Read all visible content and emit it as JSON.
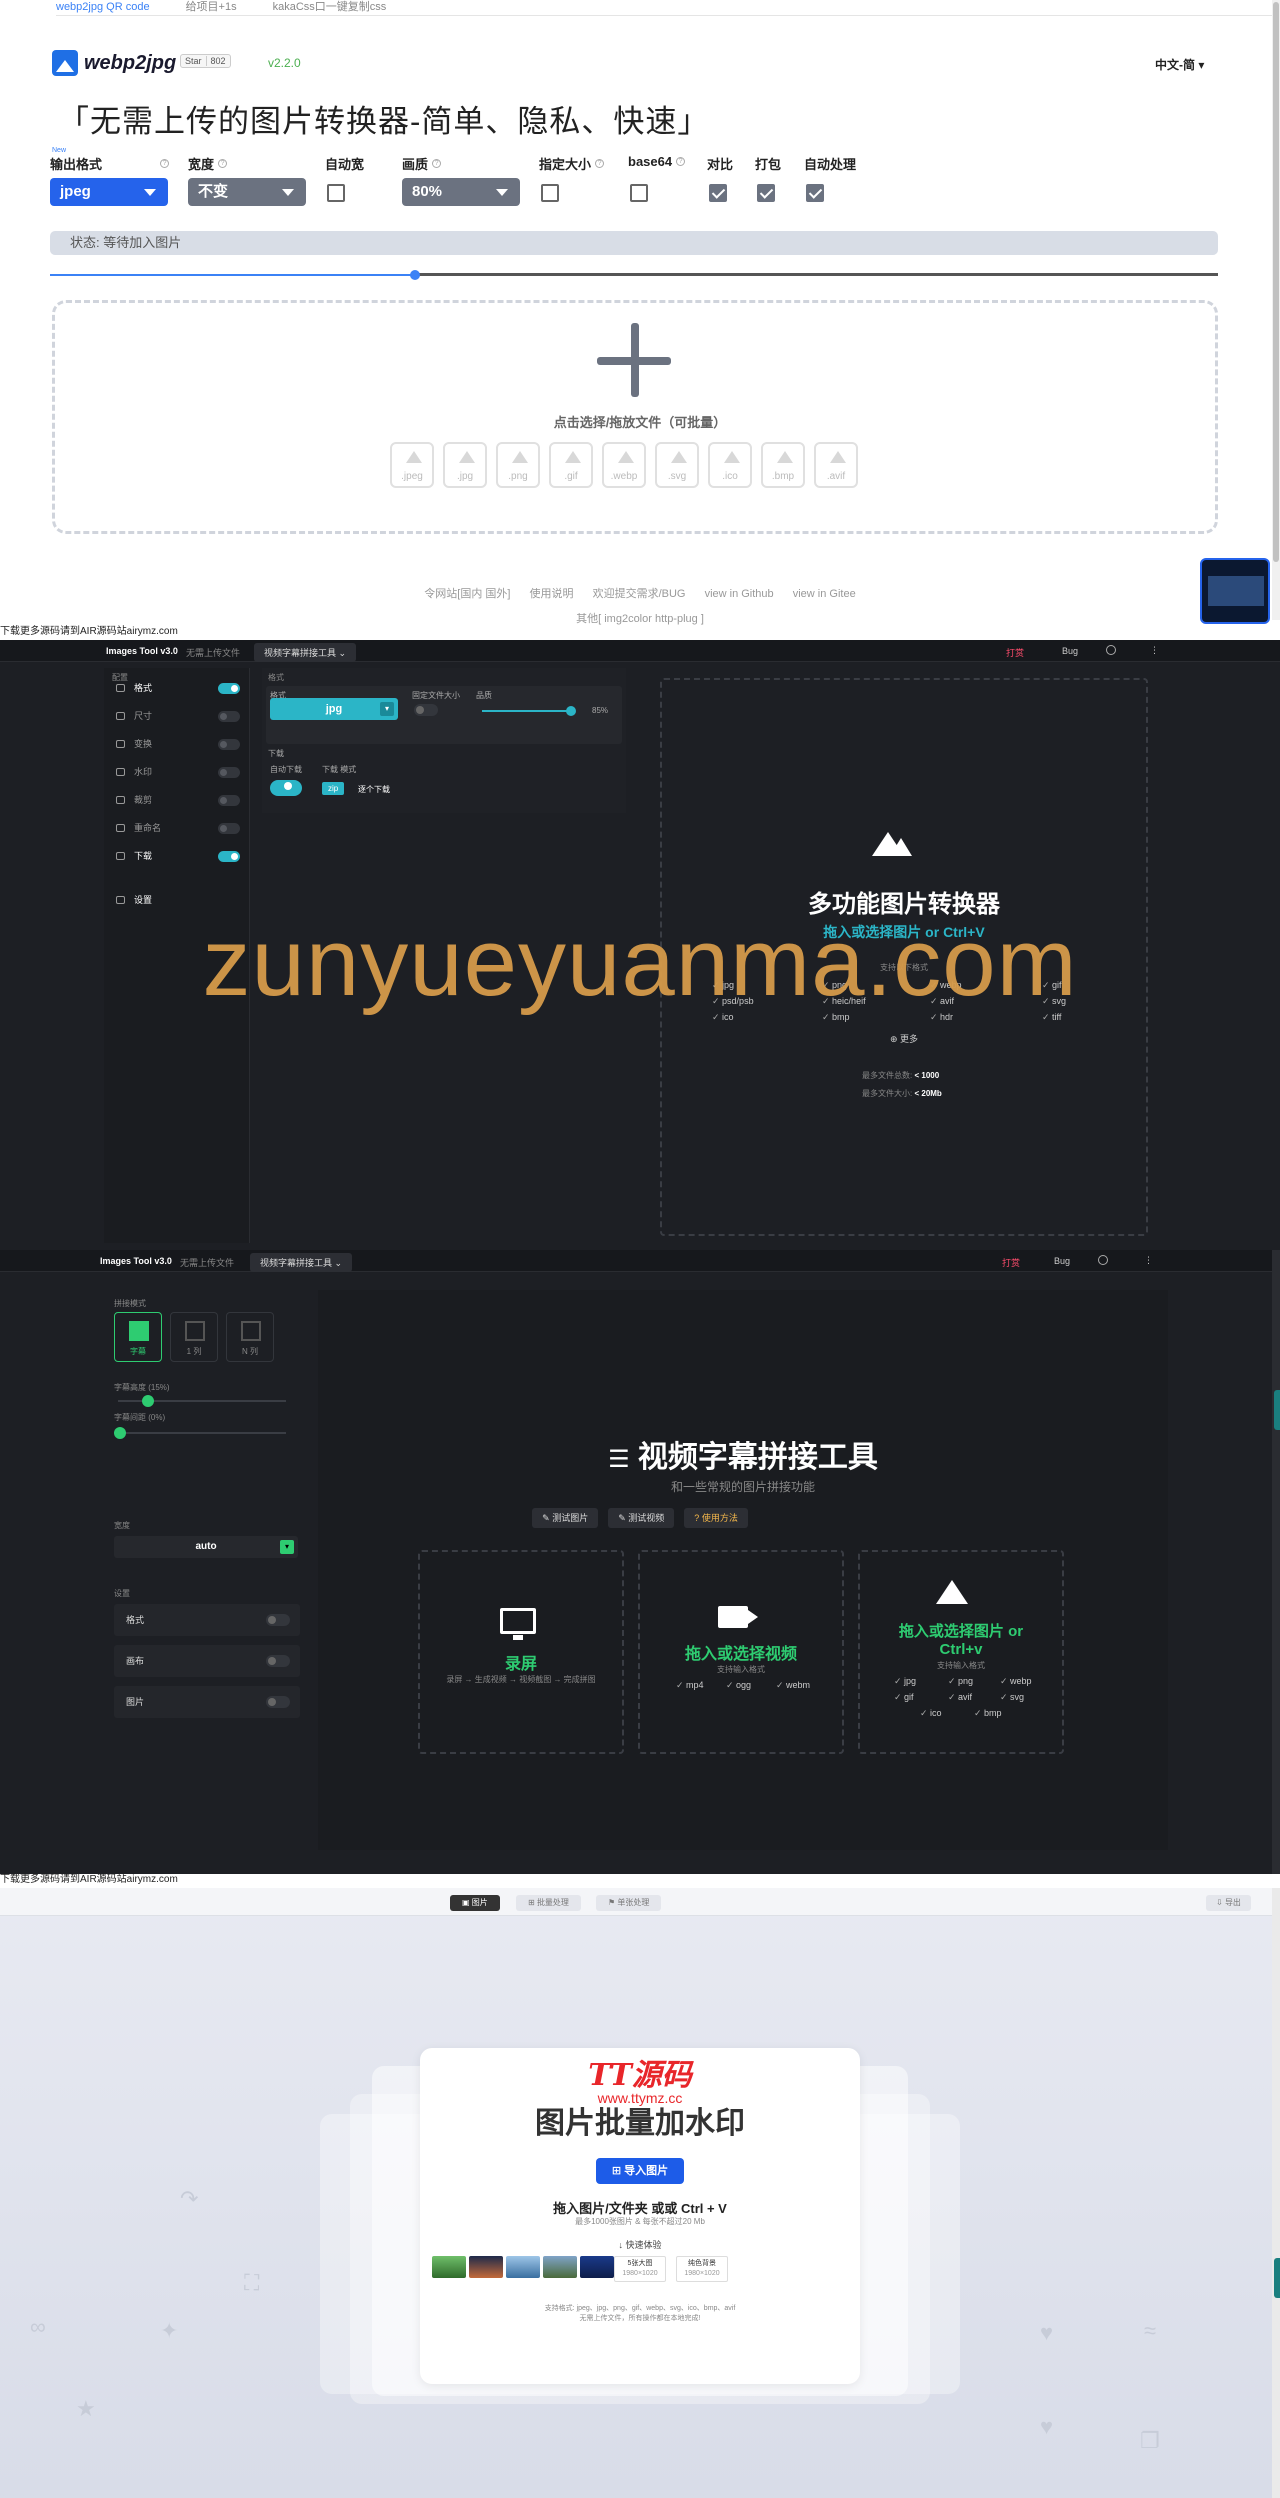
{
  "s1": {
    "top_links": [
      "webp2jpg QR code",
      "给项目+1s",
      "kakaCss口一键复制css"
    ],
    "brand": "webp2jpg",
    "star_label": "Star",
    "star_count": "802",
    "version": "v2.2.0",
    "language": "中文-简",
    "headline": "「无需上传的图片转换器-简单、隐私、快速」",
    "new_tag": "New",
    "options": {
      "format_label": "输出格式",
      "format_value": "jpeg",
      "width_label": "宽度",
      "width_value": "不变",
      "autowidth_label": "自动宽",
      "quality_label": "画质",
      "quality_value": "80%",
      "size_label": "指定大小",
      "base64_label": "base64",
      "compare_label": "对比",
      "pack_label": "打包",
      "auto_label": "自动处理"
    },
    "status": "状态: 等待加入图片",
    "drop_text": "点击选择/拖放文件（可批量）",
    "file_types": [
      ".jpeg",
      ".jpg",
      ".png",
      ".gif",
      ".webp",
      ".svg",
      ".ico",
      ".bmp",
      ".avif"
    ],
    "footer_links": [
      "令网站[国内 国外]",
      "使用说明",
      "欢迎提交需求/BUG",
      "view in Github",
      "view in Gitee"
    ],
    "footer_other": "其他[ img2color   http-plug ]",
    "credit": "下载更多源码请到AIR源码站airymz.com"
  },
  "s2": {
    "app_title": "Images Tool v3.0",
    "no_upload": "无需上传文件",
    "tool_menu": "视频字幕拼接工具 ⌄",
    "sponsor": "打赏",
    "bug": "Bug",
    "sidebar_header": "配置",
    "sidebar_items": [
      "格式",
      "尺寸",
      "变换",
      "水印",
      "裁剪",
      "重命名",
      "下载"
    ],
    "settings": "设置",
    "panel_header": "格式",
    "format_label": "格式",
    "format_value": "jpg",
    "fixed_size_label": "固定文件大小",
    "quality_label": "品质",
    "quality_value": "85%",
    "download_header": "下载",
    "auto_download": "自动下载",
    "download_mode": "下载 模式",
    "zip": "zip",
    "single": "逐个下载",
    "title": "多功能图片转换器",
    "subtitle": "拖入或选择图片 or Ctrl+V",
    "watermark": "zunyueyuanma.com",
    "supported": "支持以下格式",
    "formats": [
      "jpg",
      "png",
      "webp",
      "gif",
      "psd/psb",
      "heic/heif",
      "avif",
      "svg",
      "ico",
      "bmp",
      "hdr",
      "tiff"
    ],
    "more": "更多",
    "limit_count_label": "最多文件总数:",
    "limit_count": "< 1000",
    "limit_size_label": "最多文件大小:",
    "limit_size": "< 20Mb"
  },
  "s3": {
    "app_title": "Images Tool v3.0",
    "no_upload": "无需上传文件",
    "tool_menu": "视频字幕拼接工具 ⌄",
    "sponsor": "打赏",
    "bug": "Bug",
    "mode_header": "拼接模式",
    "modes": [
      "字幕",
      "1 列",
      "N 列"
    ],
    "subtitle_height": "字幕高度 (15%)",
    "subtitle_spacing": "字幕间距 (0%)",
    "width_label": "宽度",
    "width_value": "auto",
    "settings_header": "设置",
    "settings_rows": [
      "格式",
      "画布",
      "图片"
    ],
    "title": "视频字幕拼接工具",
    "subtitle": "和一些常规的图片拼接功能",
    "buttons": [
      "测试图片",
      "测试视频",
      "使用方法"
    ],
    "card1_title": "录屏",
    "card1_sub": "录屏 → 生成视频 → 视频截图 → 完成拼图",
    "card2_title": "拖入或选择视频",
    "card2_sub": "支持输入格式",
    "card2_formats": [
      "mp4",
      "ogg",
      "webm"
    ],
    "card3_title": "拖入或选择图片 or Ctrl+v",
    "card3_sub": "支持输入格式",
    "card3_formats": [
      "jpg",
      "png",
      "webp",
      "gif",
      "avif",
      "svg",
      "ico",
      "bmp"
    ],
    "credit": "下载更多源码请到AIR源码站airymz.com"
  },
  "s4": {
    "tabs": [
      "图片",
      "批量处理",
      "单张处理"
    ],
    "export": "导出",
    "logo_text": "TT源码",
    "logo_url": "www.ttymz.cc",
    "title": "图片批量加水印",
    "import_button": "导入图片",
    "drop_hint": "拖入图片/文件夹 或或 Ctrl + V",
    "limit_hint": "最多1000张图片 & 每张不超过20 Mb",
    "quick": "快速体验",
    "preset1_title": "5张大图",
    "preset1_size": "1980×1020",
    "preset2_title": "纯色背景",
    "preset2_size": "1980×1020",
    "formats_line": "支持格式: jpeg、jpg、png、gif、webp、svg、ico、bmp、avif",
    "privacy_line": "无需上传文件，所有操作都在本地完成!"
  },
  "colors": {
    "accent_blue": "#2563eb",
    "teal": "#2bb5c7",
    "green": "#2ecc71",
    "watermark": "#d69b4a",
    "red": "#e8262a"
  }
}
